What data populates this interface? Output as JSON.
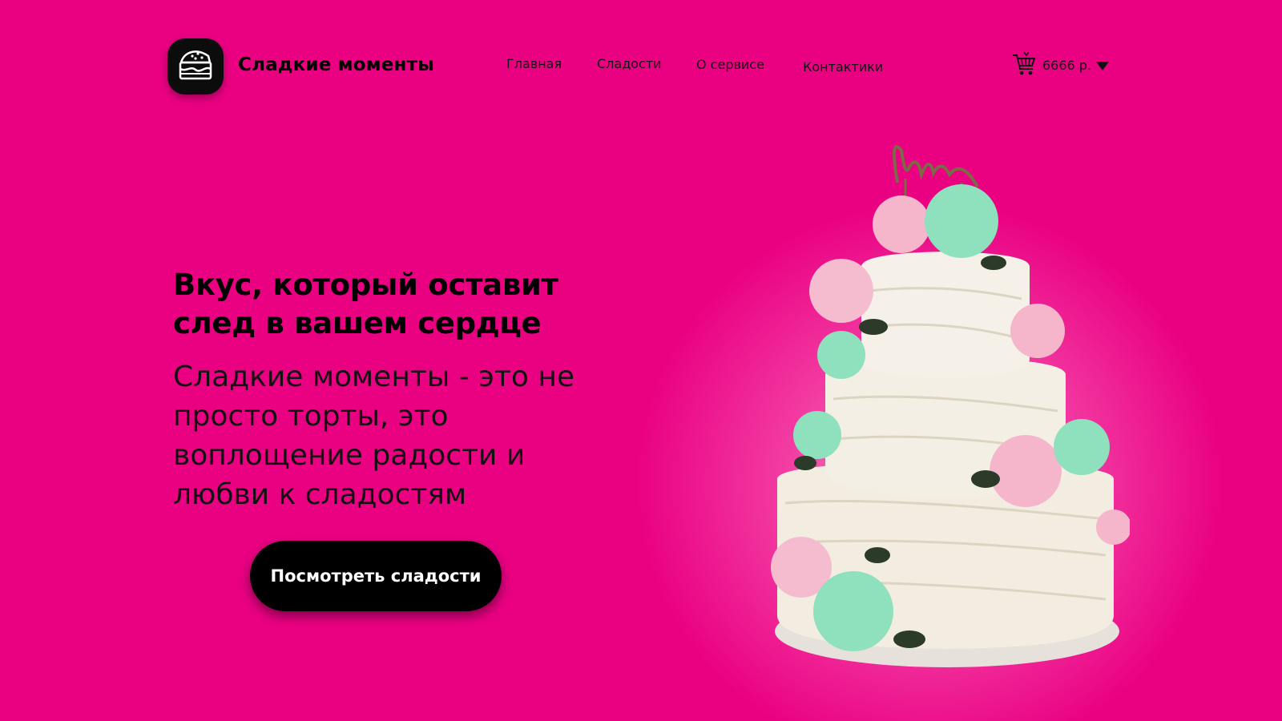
{
  "brand": {
    "name": "Сладкие моменты",
    "logo_icon": "cake-slice-icon"
  },
  "nav": {
    "items": [
      "Главная",
      "Сладости",
      "О сервисе",
      "Контактики"
    ]
  },
  "cart": {
    "icon": "shopping-cart-icon",
    "total": "6666 р.",
    "caret_icon": "caret-down-icon"
  },
  "hero": {
    "headline": "Вкус, который оставит след в вашем сердце",
    "subtitle": "Сладкие моменты - это не просто торты, это воплощение радости и любви к сладостям",
    "cta_label": "Посмотреть сладости",
    "image_alt_text_on_topper": "love"
  },
  "colors": {
    "background": "#ea0182",
    "button": "#000000",
    "text": "#000000",
    "frosting": "#f2ede0",
    "rose_pink": "#f5b6cc",
    "rose_mint": "#8fe0bd"
  }
}
